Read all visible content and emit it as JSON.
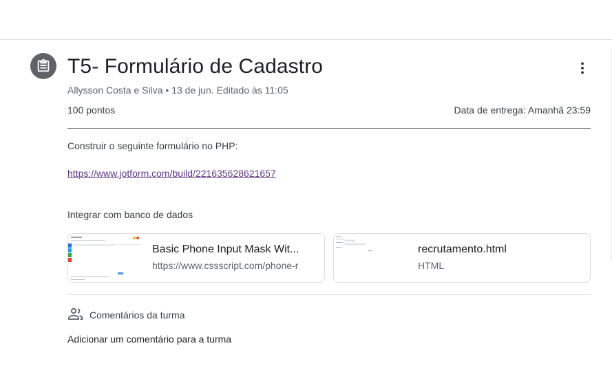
{
  "assignment": {
    "title": "T5- Formulário de Cadastro",
    "author": "Allysson Costa e Silva",
    "meta_separator": "•",
    "date": "13 de jun.",
    "edited": "Editado às 11:05",
    "points": "100 pontos",
    "due": "Data de entrega: Amanhã 23:59"
  },
  "icons": {
    "assignment": "assignment-icon",
    "more": "more-vert-icon",
    "people": "people-icon"
  },
  "description": {
    "line1": "Construir o seguinte formulário no PHP:",
    "link": "https://www.jotform.com/build/221635628621657",
    "line2": "Integrar com banco de dados"
  },
  "attachments": [
    {
      "title": "Basic Phone Input Mask Wit...",
      "subtitle": "https://www.cssscript.com/phone-r"
    },
    {
      "title": "recrutamento.html",
      "subtitle": "HTML"
    }
  ],
  "comments": {
    "title": "Comentários da turma",
    "add": "Adicionar um comentário para a turma"
  },
  "colors": {
    "link": "#5b3a8c",
    "icon_bg": "#5f6368",
    "text_primary": "#202124",
    "text_secondary": "#5f6368",
    "border": "#dadce0"
  }
}
